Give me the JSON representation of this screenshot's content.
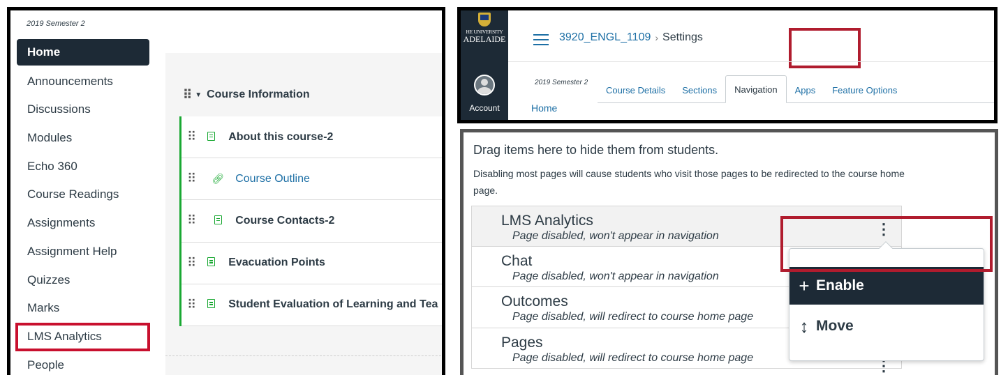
{
  "left_panel": {
    "term": "2019 Semester 2",
    "course_nav": [
      {
        "label": "Home",
        "active": true
      },
      {
        "label": "Announcements"
      },
      {
        "label": "Discussions"
      },
      {
        "label": "Modules"
      },
      {
        "label": "Echo 360"
      },
      {
        "label": "Course Readings"
      },
      {
        "label": "Assignments"
      },
      {
        "label": "Assignment Help"
      },
      {
        "label": "Quizzes"
      },
      {
        "label": "Marks"
      },
      {
        "label": "LMS Analytics",
        "highlighted": true
      },
      {
        "label": "People"
      }
    ],
    "module": {
      "title": "Course Information",
      "items": [
        {
          "title": "About this course-2",
          "icon": "page-icon",
          "indent": false,
          "link": false
        },
        {
          "title": "Course Outline",
          "icon": "link-icon",
          "indent": true,
          "link": true
        },
        {
          "title": "Course Contacts-2",
          "icon": "page-icon",
          "indent": true,
          "link": false
        },
        {
          "title": "Evacuation Points",
          "icon": "page-icon",
          "indent": false,
          "link": false
        },
        {
          "title": "Student Evaluation of Learning and Tea",
          "icon": "page-icon",
          "indent": false,
          "link": false
        }
      ]
    }
  },
  "top_right": {
    "logo": {
      "line1": "HE UNIVERSITY",
      "line2": "ADELAIDE"
    },
    "account_label": "Account",
    "breadcrumb": {
      "course": "3920_ENGL_1109",
      "separator": "›",
      "current": "Settings"
    },
    "term": "2019 Semester 2",
    "home_link": "Home",
    "tabs": [
      {
        "label": "Course Details"
      },
      {
        "label": "Sections"
      },
      {
        "label": "Navigation",
        "active": true
      },
      {
        "label": "Apps"
      },
      {
        "label": "Feature Options"
      }
    ]
  },
  "bottom_right": {
    "heading": "Drag items here to hide them from students.",
    "description": "Disabling most pages will cause students who visit those pages to be redirected to the course home page.",
    "items": [
      {
        "label": "LMS Analytics",
        "status": "Page disabled, won't appear in navigation"
      },
      {
        "label": "Chat",
        "status": "Page disabled, won't appear in navigation"
      },
      {
        "label": "Outcomes",
        "status": "Page disabled, will redirect to course home page"
      },
      {
        "label": "Pages",
        "status": "Page disabled, will redirect to course home page"
      }
    ],
    "menu": {
      "enable": {
        "icon": "+",
        "label": "Enable"
      },
      "move": {
        "icon": "↕",
        "label": "Move"
      }
    }
  },
  "colors": {
    "nav_dark": "#1d2a36",
    "link_blue": "#1d6fa5",
    "highlight_red": "#b01c2e",
    "published_green": "#19a832"
  }
}
